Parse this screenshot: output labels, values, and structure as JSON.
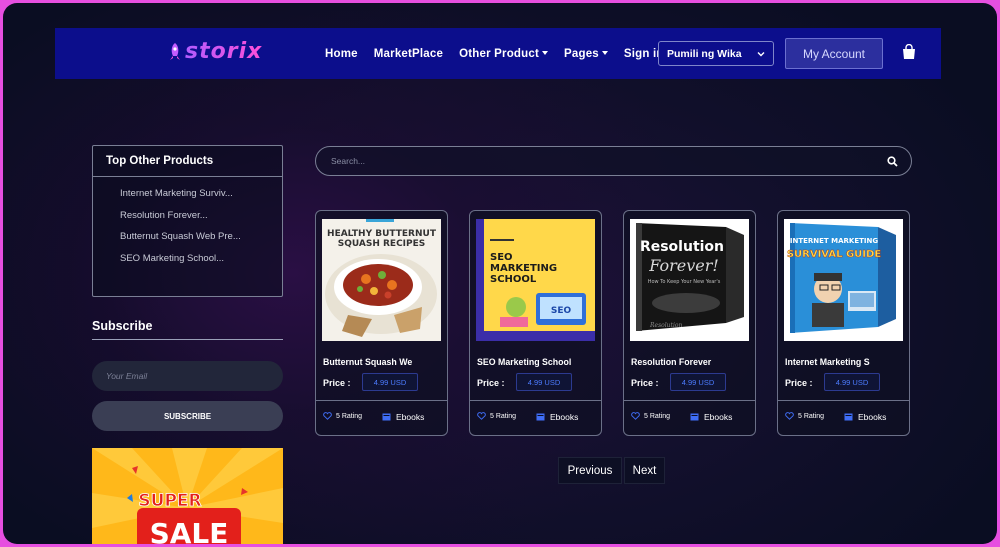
{
  "brand": {
    "logo_text": "storix"
  },
  "nav": {
    "items": [
      {
        "label": "Home",
        "dropdown": false
      },
      {
        "label": "MarketPlace",
        "dropdown": false
      },
      {
        "label": "Other Product",
        "dropdown": true
      },
      {
        "label": "Pages",
        "dropdown": true
      },
      {
        "label": "Sign in",
        "dropdown": false
      }
    ],
    "language_select": "Pumili ng Wika",
    "account_button": "My Account",
    "cart_icon": "shopping-bag-icon"
  },
  "sidebar": {
    "top_products": {
      "title": "Top Other Products",
      "items": [
        "Internet Marketing Surviv...",
        "Resolution Forever...",
        "Butternut Squash Web Pre...",
        "SEO Marketing School..."
      ]
    },
    "subscribe": {
      "title": "Subscribe",
      "email_placeholder": "Your Email",
      "button_label": "SUBSCRIBE"
    },
    "banner": {
      "line1": "SUPER",
      "line2": "SALE"
    }
  },
  "search": {
    "placeholder": "Search..."
  },
  "products": [
    {
      "title": "Butternut Squash We",
      "price_label": "Price :",
      "price": "4.99 USD",
      "rating": "5 Rating",
      "category": "Ebooks",
      "cover_text": [
        "HEALTHY BUTTERNUT",
        "SQUASH RECIPES"
      ]
    },
    {
      "title": "SEO Marketing School",
      "price_label": "Price :",
      "price": "4.99 USD",
      "rating": "5 Rating",
      "category": "Ebooks",
      "cover_text": [
        "SEO",
        "MARKETING",
        "SCHOOL",
        "SEO"
      ]
    },
    {
      "title": "Resolution Forever",
      "price_label": "Price :",
      "price": "4.99 USD",
      "rating": "5 Rating",
      "category": "Ebooks",
      "cover_text": [
        "Resolution",
        "Forever!",
        "How To Keep Your New Year's",
        "Resolution"
      ]
    },
    {
      "title": "Internet Marketing S",
      "price_label": "Price :",
      "price": "4.99 USD",
      "rating": "5 Rating",
      "category": "Ebooks",
      "cover_text": [
        "INTERNET MARKETING",
        "SURVIVAL GUIDE"
      ]
    }
  ],
  "pagination": {
    "previous": "Previous",
    "next": "Next"
  },
  "colors": {
    "navbar_bg": "#0c0e8c",
    "page_bg": "#0a0d22",
    "frame_border": "#e64fe0",
    "price_text": "#4c7cff",
    "icon_accent": "#3f6df5"
  }
}
